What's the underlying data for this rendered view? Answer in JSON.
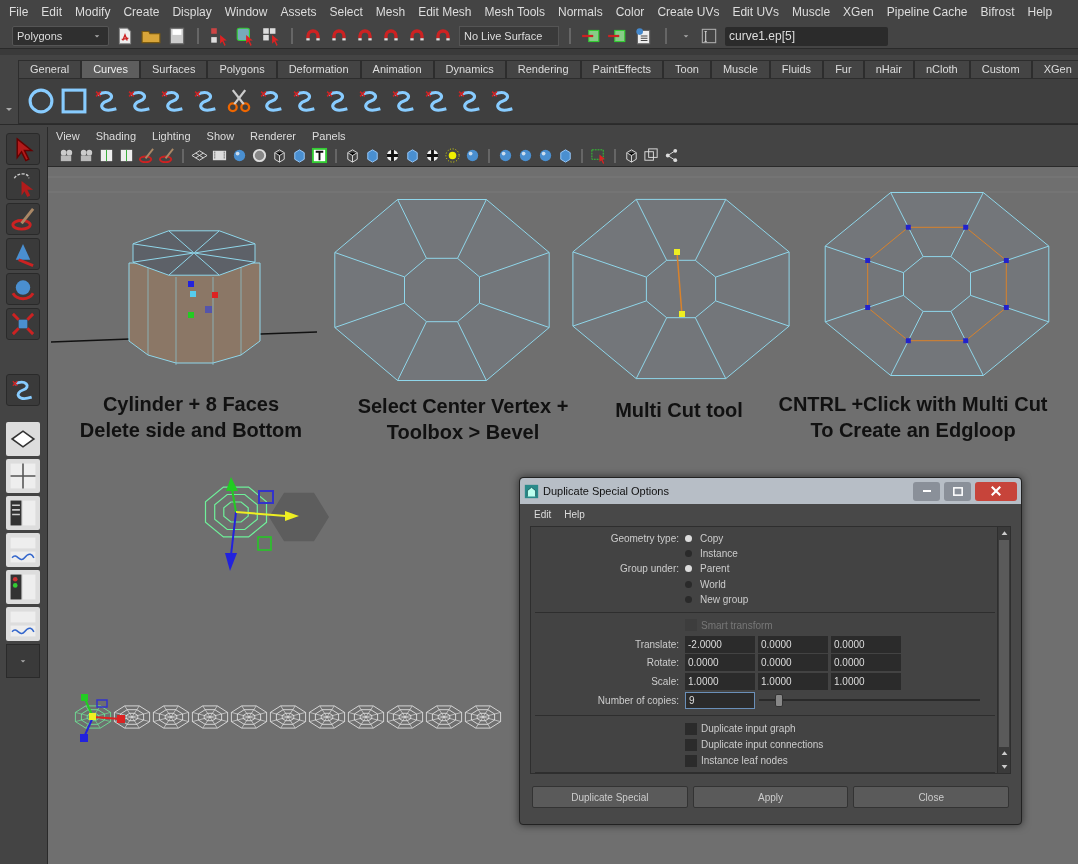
{
  "menu_bar": [
    "File",
    "Edit",
    "Modify",
    "Create",
    "Display",
    "Window",
    "Assets",
    "Select",
    "Mesh",
    "Edit Mesh",
    "Mesh Tools",
    "Normals",
    "Color",
    "Create UVs",
    "Edit UVs",
    "Muscle",
    "XGen",
    "Pipeline Cache",
    "Bifrost",
    "Help"
  ],
  "status_line": {
    "mode_dropdown": "Polygons",
    "live_surface": "No Live Surface",
    "selection_field": "curve1.ep[5]"
  },
  "shelf": {
    "tabs": [
      {
        "label": "General",
        "selected": false
      },
      {
        "label": "Curves",
        "selected": true
      },
      {
        "label": "Surfaces",
        "selected": false
      },
      {
        "label": "Polygons",
        "selected": false
      },
      {
        "label": "Deformation",
        "selected": false
      },
      {
        "label": "Animation",
        "selected": false
      },
      {
        "label": "Dynamics",
        "selected": false
      },
      {
        "label": "Rendering",
        "selected": false
      },
      {
        "label": "PaintEffects",
        "selected": false
      },
      {
        "label": "Toon",
        "selected": false
      },
      {
        "label": "Muscle",
        "selected": false
      },
      {
        "label": "Fluids",
        "selected": false
      },
      {
        "label": "Fur",
        "selected": false
      },
      {
        "label": "nHair",
        "selected": false
      },
      {
        "label": "nCloth",
        "selected": false
      },
      {
        "label": "Custom",
        "selected": false
      },
      {
        "label": "XGen",
        "selected": false
      }
    ]
  },
  "panel_menu": [
    "View",
    "Shading",
    "Lighting",
    "Show",
    "Renderer",
    "Panels"
  ],
  "viewport": {
    "captions": [
      {
        "lines": [
          "Cylinder + 8 Faces",
          "Delete side and Bottom"
        ]
      },
      {
        "lines": [
          "Select Center Vertex +",
          "Toolbox > Bevel"
        ]
      },
      {
        "lines": [
          "Multi Cut tool"
        ]
      },
      {
        "lines": [
          "CNTRL +Click with Multi Cut",
          "To Create an Edgloop"
        ]
      }
    ]
  },
  "dialog": {
    "title": "Duplicate Special Options",
    "menu": [
      "Edit",
      "Help"
    ],
    "geometry_type": {
      "label": "Geometry type:",
      "options": [
        {
          "label": "Copy",
          "selected": true
        },
        {
          "label": "Instance",
          "selected": false
        }
      ]
    },
    "group_under": {
      "label": "Group under:",
      "options": [
        {
          "label": "Parent",
          "selected": true
        },
        {
          "label": "World",
          "selected": false
        },
        {
          "label": "New group",
          "selected": false
        }
      ]
    },
    "smart_transform": {
      "label": "Smart transform",
      "checked": false,
      "disabled": true
    },
    "vectors": [
      {
        "label": "Translate:",
        "values": [
          "-2.0000",
          "0.0000",
          "0.0000"
        ]
      },
      {
        "label": "Rotate:",
        "values": [
          "0.0000",
          "0.0000",
          "0.0000"
        ]
      },
      {
        "label": "Scale:",
        "values": [
          "1.0000",
          "1.0000",
          "1.0000"
        ]
      }
    ],
    "copies": {
      "label": "Number of copies:",
      "value": "9",
      "level": 0.09
    },
    "options": [
      {
        "label": "Duplicate input graph",
        "checked": false
      },
      {
        "label": "Duplicate input connections",
        "checked": false
      },
      {
        "label": "Instance leaf nodes",
        "checked": false
      }
    ],
    "buttons": [
      "Duplicate Special",
      "Apply",
      "Close"
    ]
  }
}
